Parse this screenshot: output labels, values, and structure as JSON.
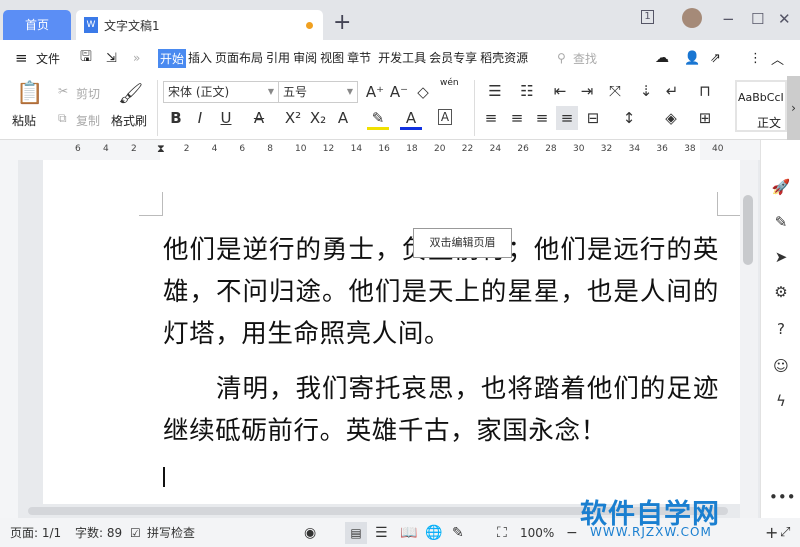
{
  "tabs": {
    "home": "首页",
    "doc": "文字文稿1",
    "new_tab": "+"
  },
  "window": {
    "layout_num": "1",
    "minimize": "−",
    "maximize": "☐",
    "close": "✕"
  },
  "menu": {
    "hamburger": "≡",
    "file": "文件",
    "items": [
      "开始",
      "插入",
      "页面布局",
      "引用",
      "审阅",
      "视图",
      "章节",
      "开发工具",
      "会员专享",
      "稻壳资源"
    ],
    "active_index": 0,
    "search": "查找"
  },
  "ribbon": {
    "paste": "粘贴",
    "cut": "剪切",
    "copy": "复制",
    "format_painter": "格式刷",
    "font_name": "宋体 (正文)",
    "font_size": "五号",
    "style_preview": "AaBbCcI",
    "style_name": "正文",
    "pinyin": "wén"
  },
  "ruler": {
    "ticks": [
      "6",
      "4",
      "2",
      "2",
      "4",
      "6",
      "8",
      "10",
      "12",
      "14",
      "16",
      "18",
      "20",
      "22",
      "24",
      "26",
      "28",
      "30",
      "32",
      "34",
      "36",
      "38",
      "40"
    ]
  },
  "document": {
    "paragraphs": [
      "他们是逆行的勇士，负重前行；他们是远行的英雄，不问归途。他们是天上的星星，也是人间的灯塔，用生命照亮人间。",
      "　　清明，我们寄托哀思，也将踏着他们的足迹继续砥砺前行。英雄千古，家国永念！"
    ],
    "tooltip": "双击编辑页眉"
  },
  "status": {
    "page": "页面: 1/1",
    "words": "字数: 89",
    "spellcheck": "拼写检查",
    "zoom": "100%"
  },
  "watermark": {
    "title": "软件自学网",
    "url": "WWW.RJZXW.COM"
  },
  "colors": {
    "accent": "#4a8af0",
    "home_tab": "#5b8ef5"
  }
}
